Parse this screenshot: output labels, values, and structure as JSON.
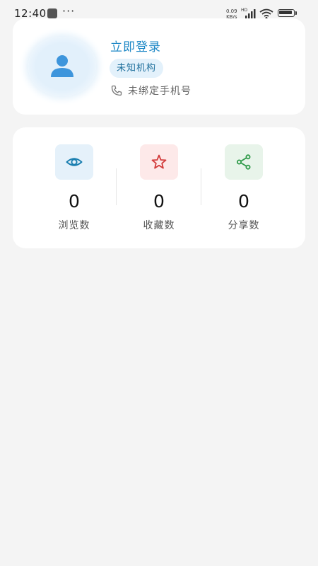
{
  "status_bar": {
    "time": "12:40",
    "menu_dots": "···",
    "speed_value": "0.09",
    "speed_unit": "KB/s",
    "network_type": "HD"
  },
  "profile": {
    "login_label": "立即登录",
    "org_badge": "未知机构",
    "phone_status": "未绑定手机号"
  },
  "stats": [
    {
      "value": "0",
      "label": "浏览数",
      "icon": "eye-icon",
      "color": "#1b7fb0",
      "bg": "#e5f1fa"
    },
    {
      "value": "0",
      "label": "收藏数",
      "icon": "star-icon",
      "color": "#d23a3a",
      "bg": "#fde9e9"
    },
    {
      "value": "0",
      "label": "分享数",
      "icon": "share-icon",
      "color": "#2d9a48",
      "bg": "#e8f4ea"
    }
  ],
  "colors": {
    "accent": "#1e88c6",
    "background": "#f4f4f4",
    "card": "#ffffff"
  }
}
